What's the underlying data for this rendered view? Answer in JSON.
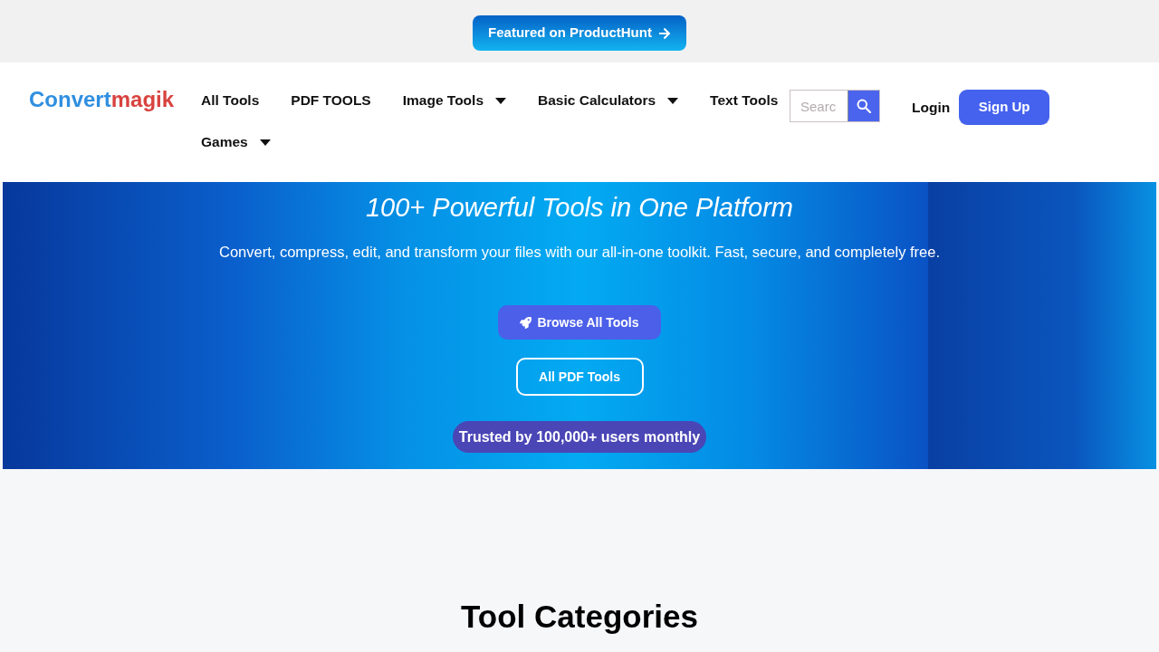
{
  "promo_bar": {
    "button": "Featured on ProductHunt"
  },
  "header": {
    "logo": {
      "primary": "Convert",
      "accent": "magik"
    },
    "nav": [
      {
        "label": "All Tools",
        "dropdown": false
      },
      {
        "label": "PDF TOOLS",
        "dropdown": false
      },
      {
        "label": "Image Tools",
        "dropdown": true
      },
      {
        "label": "Basic Calculators",
        "dropdown": true
      },
      {
        "label": "Text Tools",
        "dropdown": false
      },
      {
        "label": "Games",
        "dropdown": true
      }
    ],
    "search": {
      "placeholder": "Searc"
    },
    "login": "Login",
    "signup": "Sign Up"
  },
  "hero": {
    "title": "100+ Powerful Tools in One Platform",
    "subtitle": "Convert, compress, edit, and transform your files with our all-in-one toolkit. Fast, secure, and completely free.",
    "primary_button": "Browse All Tools",
    "secondary_button": "All PDF Tools",
    "badge": "Trusted by 100,000+ users monthly"
  },
  "categories": {
    "heading": "Tool Categories"
  }
}
